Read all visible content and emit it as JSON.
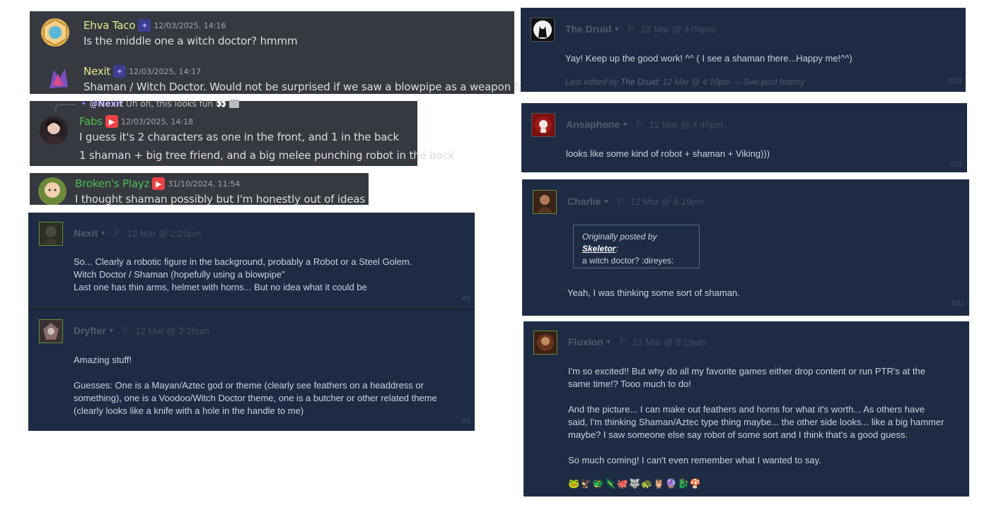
{
  "discord": {
    "panel1": [
      {
        "name": "Ehva Taco",
        "name_color": "#e6ec8c",
        "time": "12/03/2025, 14:16",
        "text": "Is the middle one a witch doctor? hmmm",
        "avatar_icon": "taco-avatar-icon"
      },
      {
        "name": "Nexit",
        "name_color": "#e6ec8c",
        "time": "12/03/2025, 14:17",
        "text": "Shaman / Witch Doctor. Would not be surprised if we saw a blowpipe as a weapon for him",
        "avatar_icon": "nexit-avatar-icon"
      }
    ],
    "panel2": {
      "reply": {
        "mention": "@Nexit",
        "text": "Uh oh, this looks fun 👀"
      },
      "name": "Fabs",
      "name_color": "#4fc04f",
      "time": "12/03/2025, 14:18",
      "lines": [
        "I guess it's 2 characters as one in the front, and 1 in the back",
        "1 shaman + big tree friend, and a big melee punching robot in the back"
      ]
    },
    "panel3": {
      "name": "Broken's Playz",
      "name_color": "#4fc04f",
      "time": "31/10/2024, 11:54",
      "text": "I thought shaman possibly but I'm honestly out of ideas haha"
    }
  },
  "steam_left": [
    {
      "name": "Nexit",
      "date": "12 Mar @ 2:25pm",
      "number": "#8",
      "lines": [
        "So... Clearly a robotic figure in the background, probably a Robot or a Steel Golem.",
        "Witch Doctor / Shaman (hopefully using a blowpipe\"",
        "Last one has thin arms, helmet with horns... But no idea what it could be"
      ]
    },
    {
      "name": "Dryfter",
      "date": "12 Mar @ 2:26pm",
      "number": "#9",
      "lines": [
        "Amazing stuff!",
        "",
        "Guesses: One is a Mayan/Aztec god or theme (clearly see feathers on a headdress or",
        "something), one is a Voodoo/Witch Doctor theme, one is a butcher or other related theme",
        "(clearly looks like a knife with a hole in the handle to me)"
      ]
    }
  ],
  "steam_right": {
    "druid": {
      "name": "The Druid",
      "date": "12 Mar @ 4:09pm",
      "number": "#20",
      "text": "Yay! Keep up the good work! ^^ ( I see a shaman there...Happy me!^^)",
      "edit_prefix": "Last edited by ",
      "edit_name": "The Druid",
      "edit_suffix": "; 12 Mar @ 4:10pm — See post history"
    },
    "ansaphone": {
      "name": "Ansaphone",
      "date": "12 Mar @ 4:45pm",
      "number": "#22",
      "text": "looks like some kind of robot + shaman + Viking)))"
    },
    "charlie": {
      "name": "Charlie",
      "date": "12 Mar @ 6:19pm",
      "number": "#31",
      "quote_prefix": "Originally posted by ",
      "quote_author": "Skeletor",
      "quote_colon": ":",
      "quote_text": "a witch doctor? :direyes:",
      "text": "Yeah, I was thinking some sort of shaman."
    },
    "fluxion": {
      "name": "Fluxion",
      "date": "12 Mar @ 9:19pm",
      "lines": [
        "I'm so excited!! But why do all my favorite games either drop content or run PTR's at the",
        "same time!? Tooo much to do!",
        "",
        "And the picture... I can make out feathers and horns for what it's worth... As others have",
        "said, I'm thinking Shaman/Aztec type thing maybe... the other side looks... like a big hammer",
        "maybe? I saw someone else say robot of some sort and I think that's a good guess.",
        "",
        "So much coming! I can't even remember what I wanted to say."
      ],
      "emotes": [
        "🐸",
        "🦅",
        "🐲",
        "🦎",
        "🐙",
        "🐺",
        "🐢",
        "🦉",
        "🔮",
        "🐉",
        "🍄"
      ]
    }
  },
  "colors": {
    "discord_bg": "#36393f",
    "steam_bg": "#1d2c44",
    "steam_muted": "#4f5d6d",
    "stream_red": "#ed4245"
  }
}
